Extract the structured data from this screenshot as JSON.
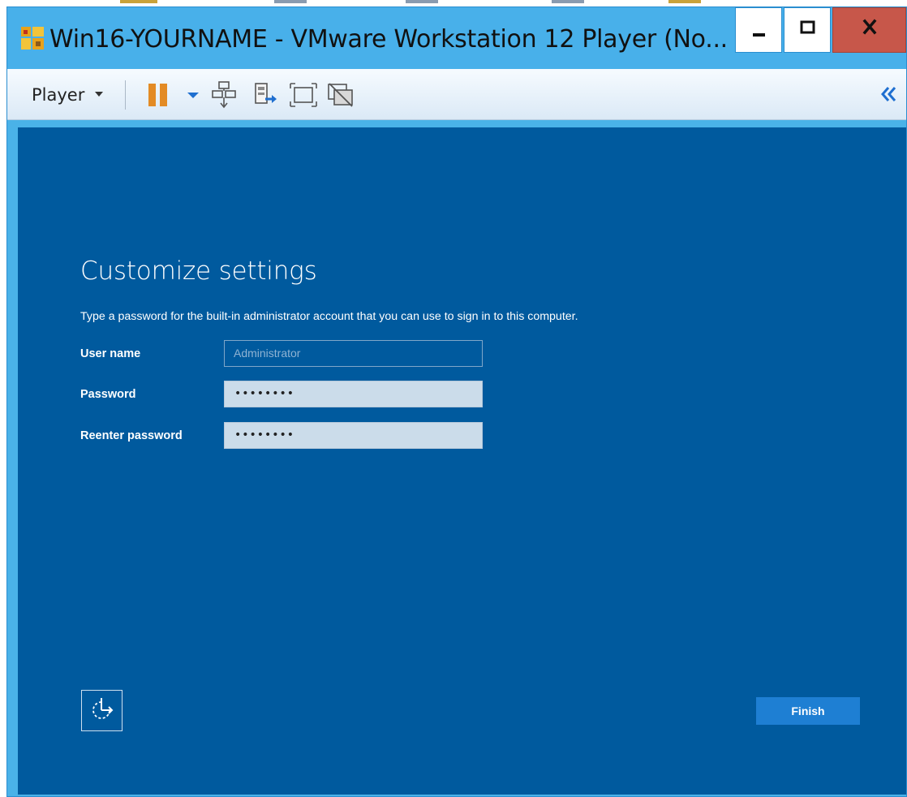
{
  "window": {
    "title": "Win16-YOURNAME - VMware Workstation 12 Player (No...",
    "minimize_glyph": "–",
    "maximize_glyph": "□",
    "close_glyph": "x"
  },
  "toolbar": {
    "player_menu_label": "Player",
    "icons": [
      "pause-icon",
      "dropdown-caret-icon",
      "send-ctrl-alt-del-icon",
      "removable-devices-icon",
      "full-screen-icon",
      "unity-icon",
      "collapse-toolbar-icon"
    ]
  },
  "setup": {
    "title": "Customize settings",
    "instructions": "Type a password for the built-in administrator account that you can use to sign in to this computer.",
    "fields": {
      "username": {
        "label": "User name",
        "placeholder": "Administrator",
        "value": ""
      },
      "password": {
        "label": "Password",
        "value_masked": "••••••••"
      },
      "reenter": {
        "label": "Reenter password",
        "value_masked": "••••••••"
      }
    },
    "finish_label": "Finish"
  },
  "colors": {
    "titlebar": "#48b0ea",
    "vm_background": "#005a9e",
    "finish_button": "#1e7fd3",
    "close_button": "#c7574a",
    "pause_icon": "#e38b25"
  }
}
